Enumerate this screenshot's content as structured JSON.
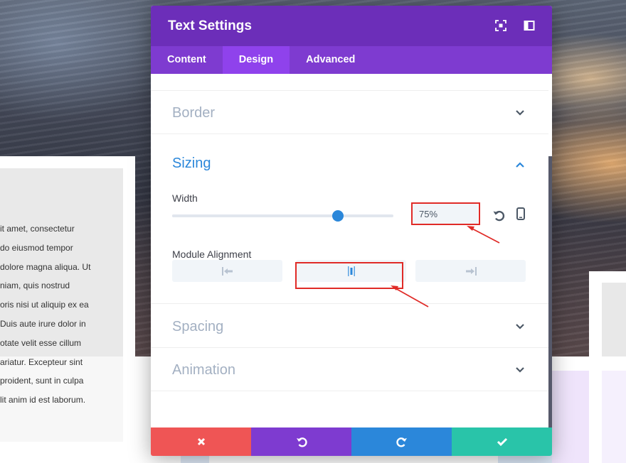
{
  "background": {
    "left_text_lines": [
      "it amet, consectetur",
      "do eiusmod tempor",
      "dolore magna aliqua. Ut",
      "niam, quis nostrud",
      "oris nisi ut aliquip ex ea",
      "Duis aute irure dolor in",
      "otate velit esse cillum",
      "ariatur. Excepteur sint",
      "proident, sunt in culpa",
      "lit anim id est laborum."
    ]
  },
  "modal": {
    "title": "Text Settings",
    "header_icons": [
      "expand-icon",
      "sidebar-dock-icon"
    ],
    "tabs": [
      {
        "label": "Content",
        "active": false
      },
      {
        "label": "Design",
        "active": true
      },
      {
        "label": "Advanced",
        "active": false
      }
    ],
    "sections": {
      "border": {
        "title": "Border",
        "expanded": false
      },
      "sizing": {
        "title": "Sizing",
        "expanded": true,
        "width_label": "Width",
        "width_value": "75%",
        "width_slider_fraction": 0.75,
        "module_alignment_label": "Module Alignment",
        "alignment_options": [
          "left",
          "center",
          "right"
        ],
        "alignment_selected": "center"
      },
      "spacing": {
        "title": "Spacing",
        "expanded": false
      },
      "animation": {
        "title": "Animation",
        "expanded": false
      }
    },
    "footer": {
      "buttons": [
        {
          "name": "discard",
          "icon": "close-icon",
          "color": "#ef5555"
        },
        {
          "name": "undo",
          "icon": "undo-icon",
          "color": "#7e3bd0"
        },
        {
          "name": "redo",
          "icon": "redo-icon",
          "color": "#2b87da"
        },
        {
          "name": "save",
          "icon": "check-icon",
          "color": "#29c4a9"
        }
      ]
    }
  },
  "colors": {
    "header": "#6c2eb9",
    "tabs": "#7e3bd0",
    "active_tab": "#8f42ec",
    "accent": "#2b87da",
    "annotation_red": "#e02b27"
  }
}
